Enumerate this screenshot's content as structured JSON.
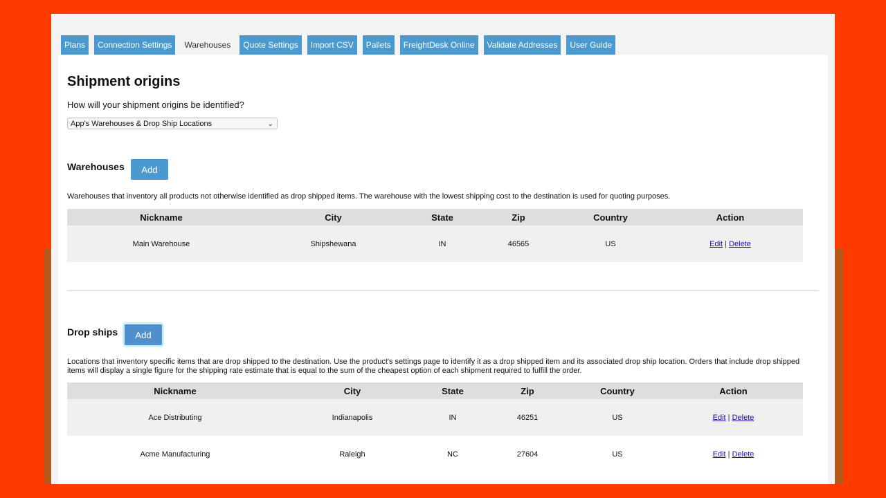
{
  "tabs": [
    {
      "label": "Plans",
      "active": false
    },
    {
      "label": "Connection Settings",
      "active": false
    },
    {
      "label": "Warehouses",
      "active": true
    },
    {
      "label": "Quote Settings",
      "active": false
    },
    {
      "label": "Import CSV",
      "active": false
    },
    {
      "label": "Pallets",
      "active": false
    },
    {
      "label": "FreightDesk Online",
      "active": false
    },
    {
      "label": "Validate Addresses",
      "active": false
    },
    {
      "label": "User Guide",
      "active": false
    }
  ],
  "origins": {
    "title": "Shipment origins",
    "question": "How will your shipment origins be identified?",
    "selected": "App's Warehouses & Drop Ship Locations"
  },
  "warehouses": {
    "title": "Warehouses",
    "add_label": "Add",
    "description": "Warehouses that inventory all products not otherwise identified as drop shipped items. The warehouse with the lowest shipping cost to the destination is used for quoting purposes.",
    "columns": [
      "Nickname",
      "City",
      "State",
      "Zip",
      "Country",
      "Action"
    ],
    "rows": [
      {
        "nickname": "Main Warehouse",
        "city": "Shipshewana",
        "state": "IN",
        "zip": "46565",
        "country": "US"
      }
    ]
  },
  "dropships": {
    "title": "Drop ships",
    "add_label": "Add",
    "description": "Locations that inventory specific items that are drop shipped to the destination. Use the product's settings page to identify it as a drop shipped item and its associated drop ship location. Orders that include drop shipped items will display a single figure for the shipping rate estimate that is equal to the sum of the cheapest option of each shipment required to fulfill the order.",
    "columns": [
      "Nickname",
      "City",
      "State",
      "Zip",
      "Country",
      "Action"
    ],
    "rows": [
      {
        "nickname": "Ace Distributing",
        "city": "Indianapolis",
        "state": "IN",
        "zip": "46251",
        "country": "US"
      },
      {
        "nickname": "Acme Manufacturing",
        "city": "Raleigh",
        "state": "NC",
        "zip": "27604",
        "country": "US"
      }
    ]
  },
  "actions": {
    "edit": "Edit",
    "separator": "|",
    "delete": "Delete"
  },
  "colors": {
    "accent": "#4a9ad0",
    "background": "#ff3b00",
    "link": "#1a0dab"
  }
}
